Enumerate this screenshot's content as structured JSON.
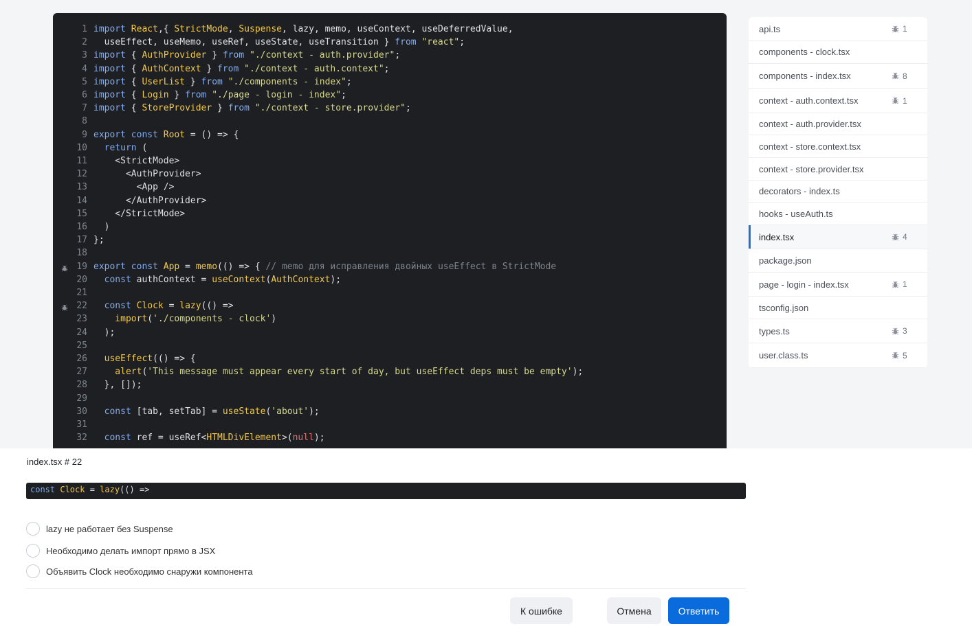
{
  "code": {
    "lines": [
      {
        "n": "1",
        "bug": false,
        "segs": [
          [
            "kw",
            "import "
          ],
          [
            "id",
            "React"
          ],
          [
            "",
            ","
          ],
          [
            "",
            "{ "
          ],
          [
            "id",
            "StrictMode"
          ],
          [
            "",
            ", "
          ],
          [
            "id",
            "Suspense"
          ],
          [
            "",
            ", lazy, memo, useContext, useDeferredValue,"
          ]
        ]
      },
      {
        "n": "2",
        "bug": false,
        "segs": [
          [
            "",
            "  useEffect, useMemo, useRef, useState, useTransition } "
          ],
          [
            "kw",
            "from "
          ],
          [
            "str",
            "\"react\""
          ],
          [
            "",
            ";"
          ]
        ]
      },
      {
        "n": "3",
        "bug": false,
        "segs": [
          [
            "kw",
            "import "
          ],
          [
            "",
            "{ "
          ],
          [
            "id",
            "AuthProvider"
          ],
          [
            "",
            " } "
          ],
          [
            "kw",
            "from "
          ],
          [
            "str",
            "\"./context - auth.provider\""
          ],
          [
            "",
            ";"
          ]
        ]
      },
      {
        "n": "4",
        "bug": false,
        "segs": [
          [
            "kw",
            "import "
          ],
          [
            "",
            "{ "
          ],
          [
            "id",
            "AuthContext"
          ],
          [
            "",
            " } "
          ],
          [
            "kw",
            "from "
          ],
          [
            "str",
            "\"./context - auth.context\""
          ],
          [
            "",
            ";"
          ]
        ]
      },
      {
        "n": "5",
        "bug": false,
        "segs": [
          [
            "kw",
            "import "
          ],
          [
            "",
            "{ "
          ],
          [
            "id",
            "UserList"
          ],
          [
            "",
            " } "
          ],
          [
            "kw",
            "from "
          ],
          [
            "str",
            "\"./components - index\""
          ],
          [
            "",
            ";"
          ]
        ]
      },
      {
        "n": "6",
        "bug": false,
        "segs": [
          [
            "kw",
            "import "
          ],
          [
            "",
            "{ "
          ],
          [
            "id",
            "Login"
          ],
          [
            "",
            " } "
          ],
          [
            "kw",
            "from "
          ],
          [
            "str",
            "\"./page - login - index\""
          ],
          [
            "",
            ";"
          ]
        ]
      },
      {
        "n": "7",
        "bug": false,
        "segs": [
          [
            "kw",
            "import "
          ],
          [
            "",
            "{ "
          ],
          [
            "id",
            "StoreProvider"
          ],
          [
            "",
            " } "
          ],
          [
            "kw",
            "from "
          ],
          [
            "str",
            "\"./context - store.provider\""
          ],
          [
            "",
            ";"
          ]
        ]
      },
      {
        "n": "8",
        "bug": false,
        "segs": []
      },
      {
        "n": "9",
        "bug": false,
        "segs": [
          [
            "kw",
            "export const "
          ],
          [
            "id",
            "Root"
          ],
          [
            "",
            " = () => {"
          ]
        ]
      },
      {
        "n": "10",
        "bug": false,
        "segs": [
          [
            "kw",
            "  return "
          ],
          [
            "",
            "("
          ]
        ]
      },
      {
        "n": "11",
        "bug": false,
        "segs": [
          [
            "",
            "    <StrictMode>"
          ]
        ]
      },
      {
        "n": "12",
        "bug": false,
        "segs": [
          [
            "",
            "      <AuthProvider>"
          ]
        ]
      },
      {
        "n": "13",
        "bug": false,
        "segs": [
          [
            "",
            "        <App />"
          ]
        ]
      },
      {
        "n": "14",
        "bug": false,
        "segs": [
          [
            "",
            "      </AuthProvider>"
          ]
        ]
      },
      {
        "n": "15",
        "bug": false,
        "segs": [
          [
            "",
            "    </StrictMode>"
          ]
        ]
      },
      {
        "n": "16",
        "bug": false,
        "segs": [
          [
            "",
            "  )"
          ]
        ]
      },
      {
        "n": "17",
        "bug": false,
        "segs": [
          [
            "",
            "};"
          ]
        ]
      },
      {
        "n": "18",
        "bug": false,
        "segs": []
      },
      {
        "n": "19",
        "bug": true,
        "segs": [
          [
            "kw",
            "export const "
          ],
          [
            "id",
            "App"
          ],
          [
            "",
            " = "
          ],
          [
            "id",
            "memo"
          ],
          [
            "",
            "(() => { "
          ],
          [
            "cm",
            "// memo для исправления двойных useEffect в StrictMode"
          ]
        ]
      },
      {
        "n": "20",
        "bug": false,
        "segs": [
          [
            "kw",
            "  const "
          ],
          [
            "",
            "authContext = "
          ],
          [
            "id",
            "useContext"
          ],
          [
            "",
            "("
          ],
          [
            "id",
            "AuthContext"
          ],
          [
            "",
            ");"
          ]
        ]
      },
      {
        "n": "21",
        "bug": false,
        "segs": []
      },
      {
        "n": "22",
        "bug": true,
        "segs": [
          [
            "kw",
            "  const "
          ],
          [
            "id",
            "Clock"
          ],
          [
            "",
            " = "
          ],
          [
            "id",
            "lazy"
          ],
          [
            "",
            "(() =>"
          ]
        ]
      },
      {
        "n": "23",
        "bug": false,
        "segs": [
          [
            "id",
            "    import"
          ],
          [
            "",
            "("
          ],
          [
            "str",
            "'./components - clock'"
          ],
          [
            "",
            ")"
          ]
        ]
      },
      {
        "n": "24",
        "bug": false,
        "segs": [
          [
            "",
            "  );"
          ]
        ]
      },
      {
        "n": "25",
        "bug": false,
        "segs": []
      },
      {
        "n": "26",
        "bug": false,
        "segs": [
          [
            "id",
            "  useEffect"
          ],
          [
            "",
            "(() => {"
          ]
        ]
      },
      {
        "n": "27",
        "bug": false,
        "segs": [
          [
            "id",
            "    alert"
          ],
          [
            "",
            "("
          ],
          [
            "str",
            "'This message must appear every start of day, but useEffect deps must be empty'"
          ],
          [
            "",
            ");"
          ]
        ]
      },
      {
        "n": "28",
        "bug": false,
        "segs": [
          [
            "",
            "  }, []);"
          ]
        ]
      },
      {
        "n": "29",
        "bug": false,
        "segs": []
      },
      {
        "n": "30",
        "bug": false,
        "segs": [
          [
            "kw",
            "  const "
          ],
          [
            "",
            "[tab, setTab] = "
          ],
          [
            "id",
            "useState"
          ],
          [
            "",
            "("
          ],
          [
            "str",
            "'about'"
          ],
          [
            "",
            ");"
          ]
        ]
      },
      {
        "n": "31",
        "bug": false,
        "segs": []
      },
      {
        "n": "32",
        "bug": false,
        "segs": [
          [
            "kw",
            "  const "
          ],
          [
            "",
            "ref = useRef<"
          ],
          [
            "id",
            "HTMLDivElement"
          ],
          [
            "",
            ">("
          ],
          [
            "nul",
            "null"
          ],
          [
            "",
            ");"
          ]
        ]
      }
    ]
  },
  "files": [
    {
      "name": "api.ts",
      "count": "1",
      "active": false
    },
    {
      "name": "components - clock.tsx",
      "count": "",
      "active": false
    },
    {
      "name": "components - index.tsx",
      "count": "8",
      "active": false
    },
    {
      "name": "context - auth.context.tsx",
      "count": "1",
      "active": false
    },
    {
      "name": "context - auth.provider.tsx",
      "count": "",
      "active": false
    },
    {
      "name": "context - store.context.tsx",
      "count": "",
      "active": false
    },
    {
      "name": "context - store.provider.tsx",
      "count": "",
      "active": false
    },
    {
      "name": "decorators - index.ts",
      "count": "",
      "active": false
    },
    {
      "name": "hooks - useAuth.ts",
      "count": "",
      "active": false
    },
    {
      "name": "index.tsx",
      "count": "4",
      "active": true
    },
    {
      "name": "package.json",
      "count": "",
      "active": false
    },
    {
      "name": "page - login - index.tsx",
      "count": "1",
      "active": false
    },
    {
      "name": "tsconfig.json",
      "count": "",
      "active": false
    },
    {
      "name": "types.ts",
      "count": "3",
      "active": false
    },
    {
      "name": "user.class.ts",
      "count": "5",
      "active": false
    }
  ],
  "question": {
    "ref": "index.tsx # 22",
    "snippet": [
      [
        "kw",
        "const "
      ],
      [
        "id",
        "Clock"
      ],
      [
        "",
        " = "
      ],
      [
        "id",
        "lazy"
      ],
      [
        "",
        "(() =>"
      ]
    ],
    "options": [
      "lazy не работает без Suspense",
      "Необходимо делать импорт прямо в JSX",
      "Объявить Clock необходимо снаружи компонента"
    ]
  },
  "buttons": {
    "report": "К ошибке",
    "cancel": "Отмена",
    "answer": "Ответить"
  }
}
